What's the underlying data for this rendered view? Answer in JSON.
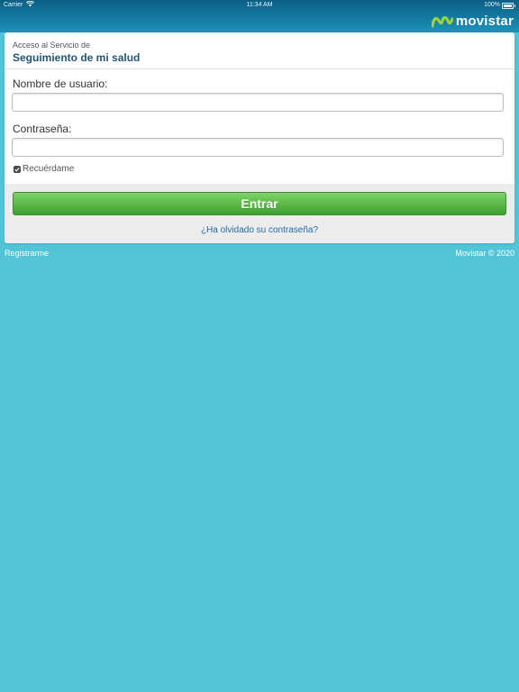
{
  "status_bar": {
    "carrier": "Carrier",
    "time": "11:34 AM",
    "battery": "100%"
  },
  "brand": {
    "name": "movistar",
    "icon": "movistar-m-logo",
    "color": "#9bd33b"
  },
  "login": {
    "subtitle": "Acceso al Servicio de",
    "title": "Seguimiento de mi salud",
    "username_label": "Nombre de usuario:",
    "username_value": "",
    "password_label": "Contraseña:",
    "password_value": "",
    "remember_label": "Recuérdame",
    "remember_checked": true,
    "enter_label": "Entrar",
    "forgot_label": "¿Ha olvidado su contraseña?"
  },
  "footer": {
    "register_label": "Registrarme",
    "copyright": "Movistar © 2020"
  },
  "colors": {
    "background": "#52c4d8",
    "header": "#137aa2",
    "title": "#1f5577",
    "button": "#5fbd4a",
    "link": "#1f6ba8"
  }
}
